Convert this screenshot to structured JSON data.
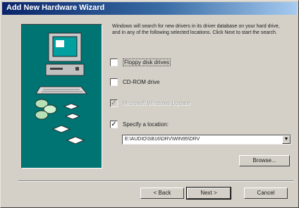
{
  "window": {
    "title": "Add New Hardware Wizard"
  },
  "description": "Windows will search for new drivers in its driver database on your hard drive, and in any of the following selected locations. Click Next to start the search.",
  "options": {
    "floppy": {
      "label": "Floppy disk drives",
      "checked": false
    },
    "cdrom": {
      "label": "CD-ROM drive",
      "checked": false
    },
    "windows_update": {
      "label": "Microsoft Windows Update",
      "checked": true,
      "enabled": false
    },
    "specify": {
      "label": "Specify a location:",
      "checked": true
    }
  },
  "location": {
    "value": "E:\\AUDIO\\SB16\\DRV\\WIN95\\DRV"
  },
  "buttons": {
    "browse": "Browse...",
    "back": "< Back",
    "next": "Next >",
    "cancel": "Cancel"
  },
  "icons": {
    "computer": "computer-icon",
    "disks": "floppy-disks-icon",
    "dropdown": "chevron-down-icon"
  }
}
